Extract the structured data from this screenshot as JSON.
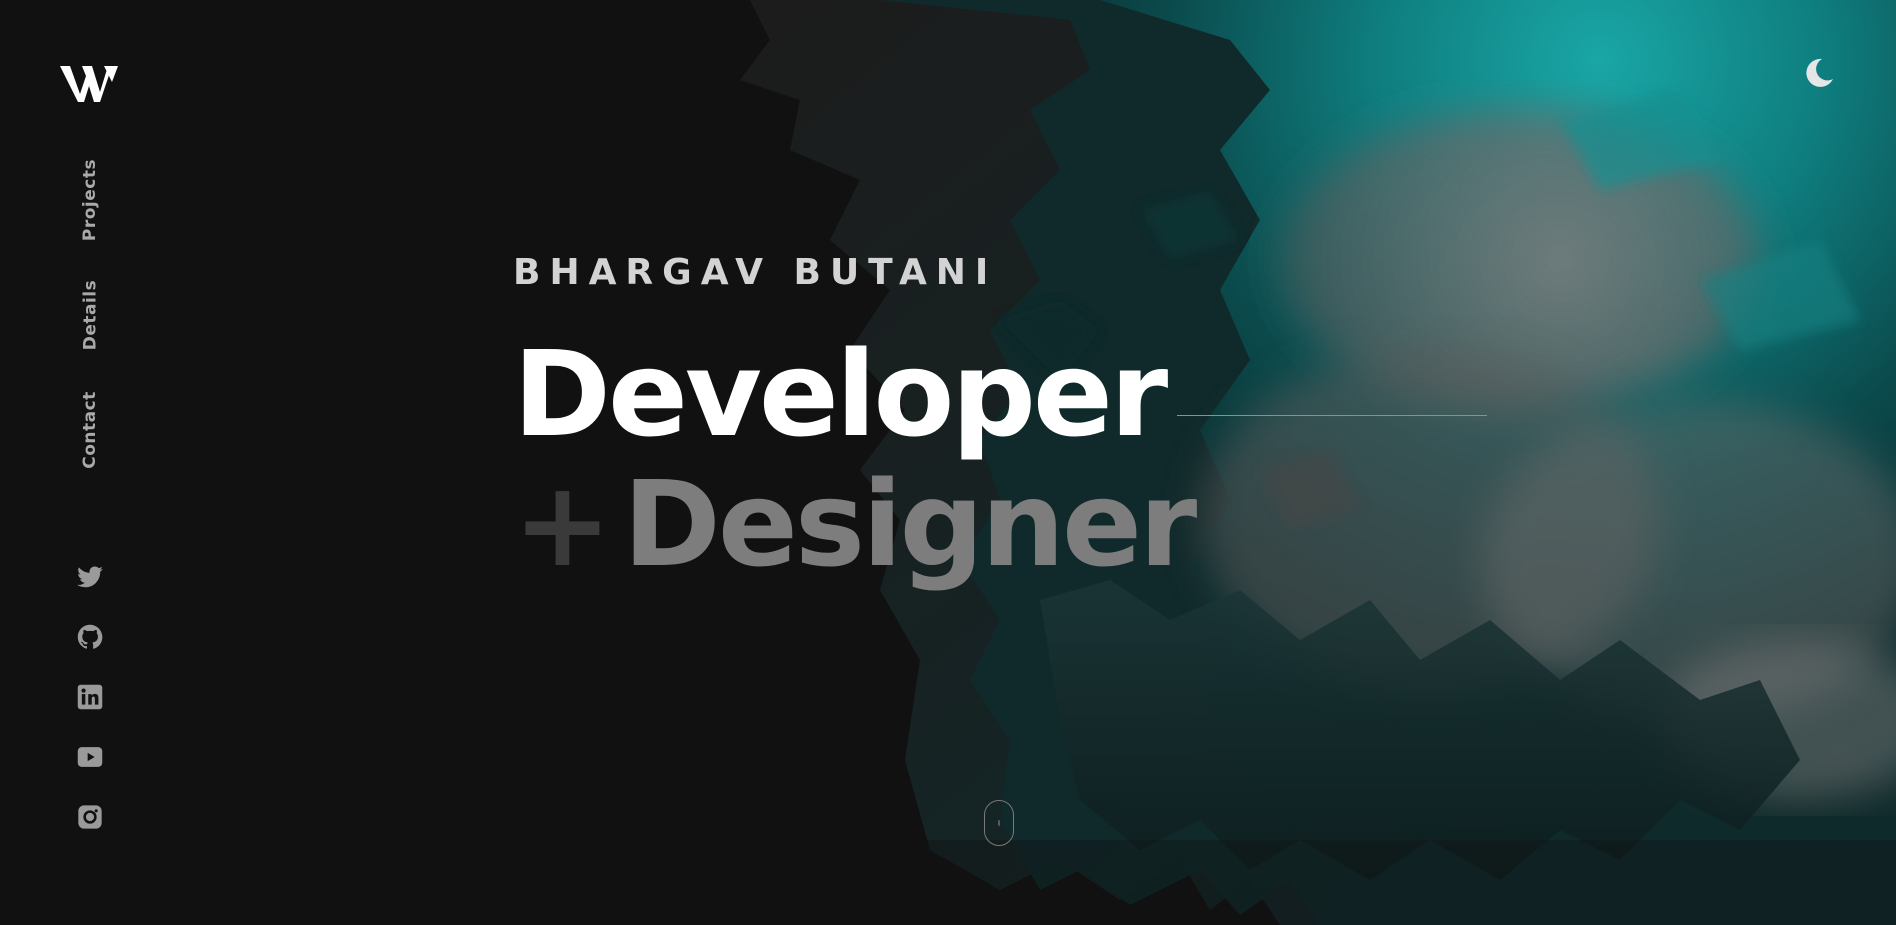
{
  "header": {
    "logo_icon": "w-monogram-logo",
    "theme_toggle_icon": "moon-icon"
  },
  "nav": {
    "items": [
      {
        "label": "Projects"
      },
      {
        "label": "Details"
      },
      {
        "label": "Contact"
      }
    ]
  },
  "socials": [
    {
      "icon": "twitter-icon"
    },
    {
      "icon": "github-icon"
    },
    {
      "icon": "linkedin-icon"
    },
    {
      "icon": "youtube-icon"
    },
    {
      "icon": "instagram-icon"
    }
  ],
  "hero": {
    "name": "BHARGAV BUTANI",
    "line1": "Developer",
    "plus": "+",
    "line2": "Designer"
  },
  "scroll_indicator": {
    "icon": "mouse-scroll-icon"
  },
  "colors": {
    "background": "#111111",
    "accent_teal": "#0f8a8a",
    "text_primary": "#ffffff",
    "text_muted": "#7d7d7d"
  }
}
